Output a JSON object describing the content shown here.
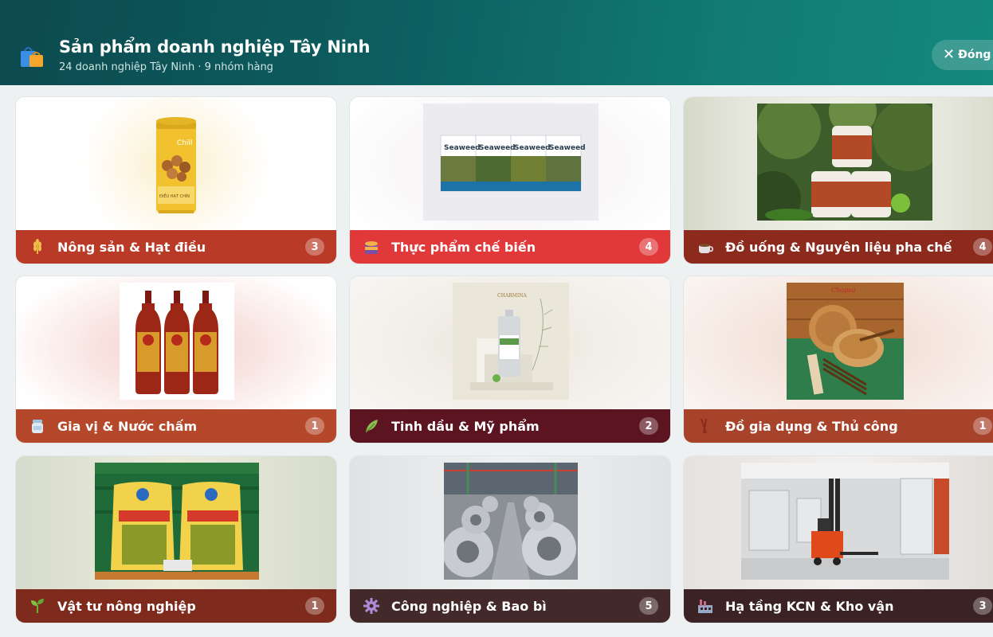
{
  "header": {
    "title": "Sản phẩm doanh nghiệp Tây Ninh",
    "subtitle": "24 doanh nghiệp Tây Ninh · 9 nhóm hàng",
    "icon": "shopping-bags-icon",
    "close_label": "Đóng"
  },
  "categories": [
    {
      "label": "Nông sản & Hạt điều",
      "count": "3",
      "icon": "wheat-icon",
      "bar_color": "#b93a26"
    },
    {
      "label": "Thực phẩm chế biến",
      "count": "4",
      "icon": "canned-food-icon",
      "bar_color": "#e1383a"
    },
    {
      "label": "Đồ uống & Nguyên liệu pha chế",
      "count": "4",
      "icon": "coffee-cup-icon",
      "bar_color": "#8c2a1e"
    },
    {
      "label": "Gia vị & Nước chấm",
      "count": "1",
      "icon": "jar-icon",
      "bar_color": "#b5482a"
    },
    {
      "label": "Tinh dầu & Mỹ phẩm",
      "count": "2",
      "icon": "leaf-icon",
      "bar_color": "#5b1420"
    },
    {
      "label": "Đồ gia dụng & Thủ công",
      "count": "1",
      "icon": "chopsticks-icon",
      "bar_color": "#a8432b"
    },
    {
      "label": "Vật tư nông nghiệp",
      "count": "1",
      "icon": "seedling-icon",
      "bar_color": "#7e2a1c"
    },
    {
      "label": "Công nghiệp & Bao bì",
      "count": "5",
      "icon": "gear-icon",
      "bar_color": "#44292a"
    },
    {
      "label": "Hạ tầng KCN & Kho vận",
      "count": "3",
      "icon": "factory-icon",
      "bar_color": "#3b2325"
    }
  ],
  "product_images": {
    "card1": {
      "pack_text_top": "Chill",
      "pack_text_bottom": "ĐIỀU HẠT CHÍN"
    },
    "card2": {
      "box_text": "Seaweed"
    },
    "card5": {
      "brand_text": "CHARMINA"
    },
    "card6": {
      "brand_text": "Chopsu"
    }
  },
  "colors": {
    "header_start": "#0c4a4f",
    "header_end": "#14887d",
    "page_bg": "#eef1f2"
  }
}
